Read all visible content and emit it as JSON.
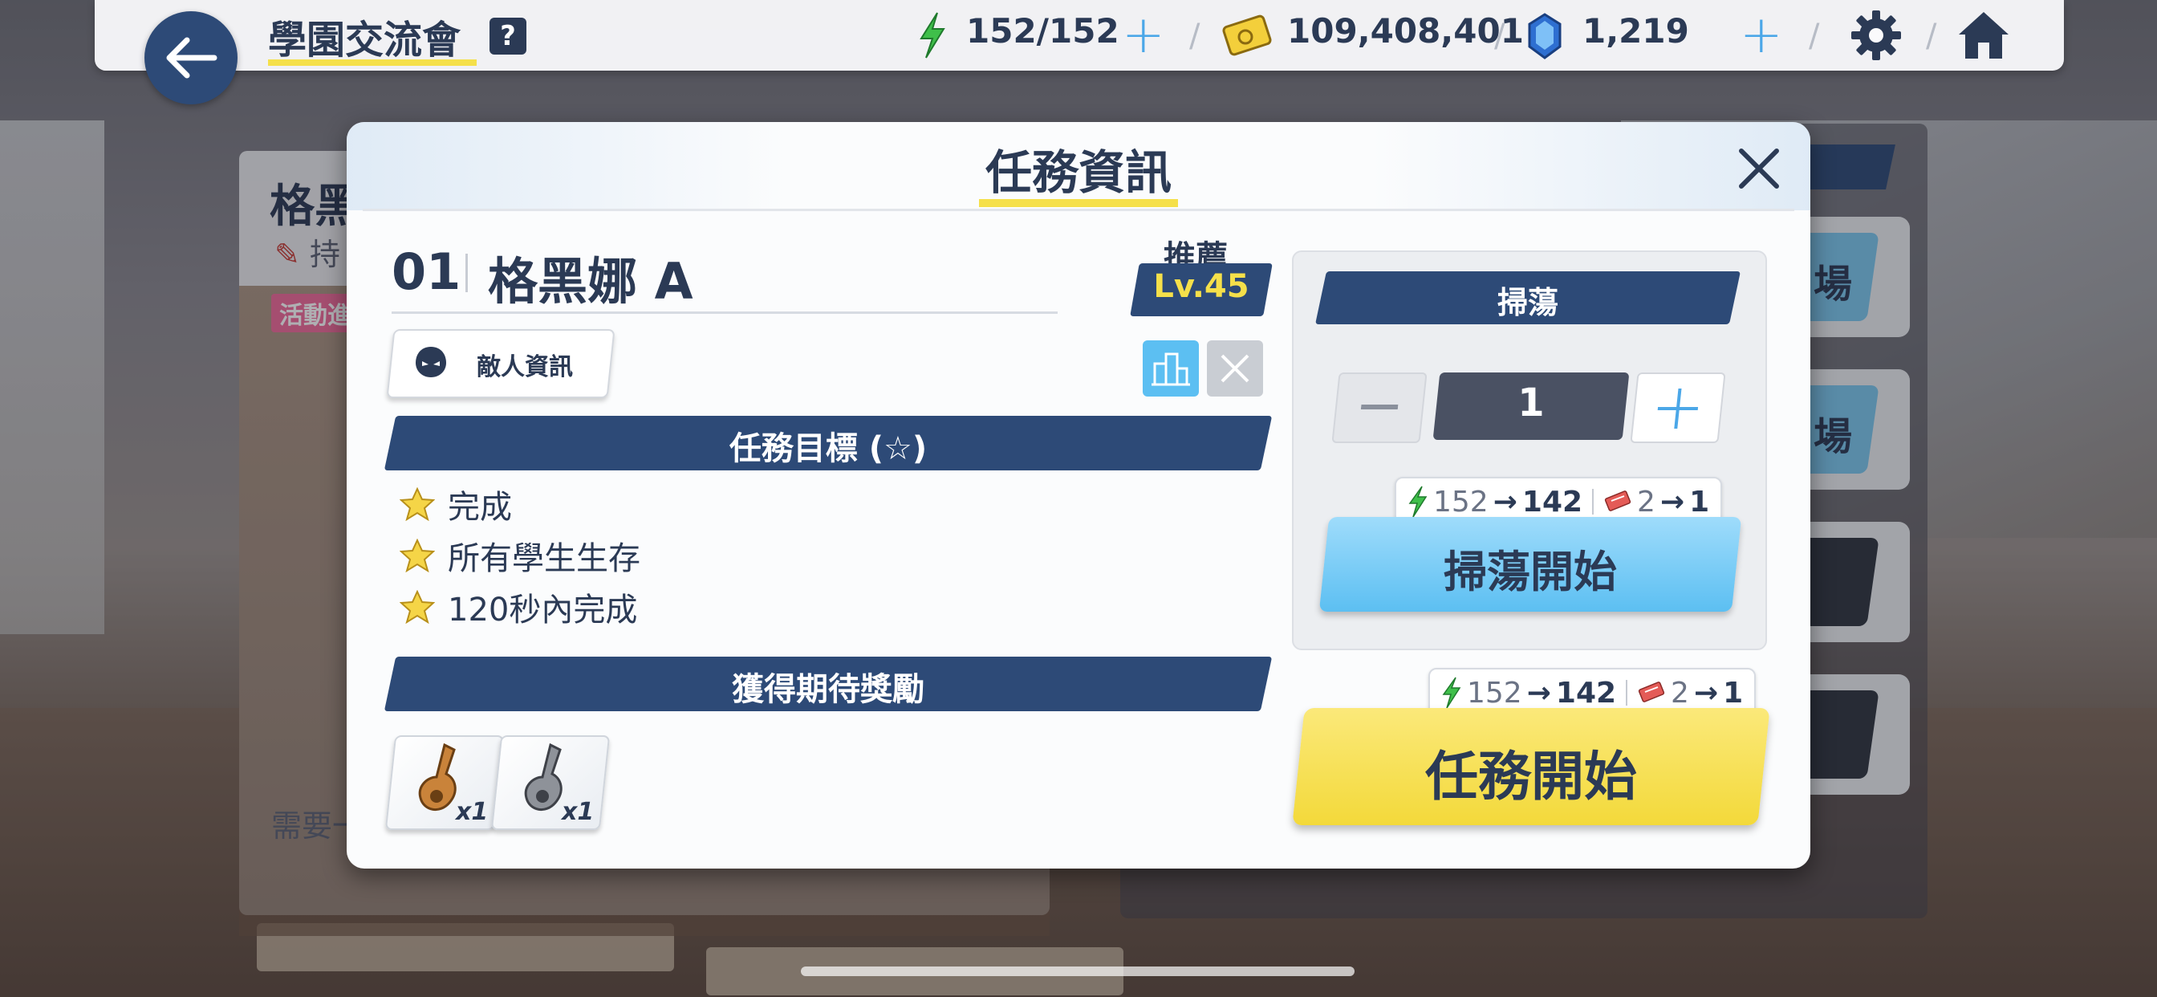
{
  "topbar": {
    "title": "學園交流會",
    "help": "?",
    "ap": "152/152",
    "credits": "109,408,401",
    "gems": "1,219"
  },
  "background_panel": {
    "stage_title": "格黑",
    "subtitle": "持",
    "event_tag": "活動進",
    "requirement": "需要一",
    "side_buttons": [
      "場",
      "場",
      "",
      ""
    ]
  },
  "modal": {
    "title": "任務資訊",
    "stage_number": "01",
    "stage_name": "格黑娜 A",
    "recommended_label": "推薦",
    "recommended_level": "Lv.45",
    "enemy_info_label": "敵人資訊",
    "objectives_header": "任務目標 (☆)",
    "objectives": [
      "完成",
      "所有學生生存",
      "120秒內完成"
    ],
    "rewards_header": "獲得期待獎勵",
    "rewards": [
      {
        "icon": "bronze-key-icon",
        "count": "x1"
      },
      {
        "icon": "silver-key-icon",
        "count": "x1"
      }
    ]
  },
  "sweep": {
    "header": "掃蕩",
    "count": "1",
    "cost": {
      "ap_from": "152",
      "ap_to": "142",
      "ticket_from": "2",
      "ticket_to": "1"
    },
    "start_label": "掃蕩開始"
  },
  "mission": {
    "cost": {
      "ap_from": "152",
      "ap_to": "142",
      "ticket_from": "2",
      "ticket_to": "1"
    },
    "start_label": "任務開始"
  },
  "colors": {
    "navy": "#2d4a77",
    "accent_yellow": "#f5e04a",
    "sweep_blue": "#5cbff2",
    "ap_green": "#3fbf4a"
  }
}
